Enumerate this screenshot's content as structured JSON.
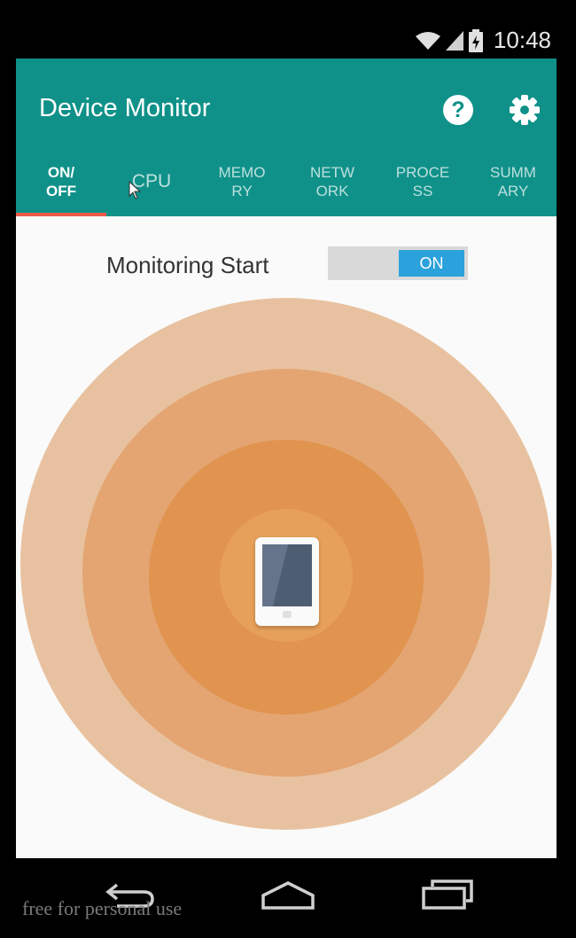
{
  "status_bar": {
    "time": "10:48",
    "icons": [
      "wifi-icon",
      "signal-icon",
      "battery-icon"
    ]
  },
  "toolbar": {
    "title": "Device Monitor",
    "help_icon": "?",
    "color": "#0f9189"
  },
  "tabs": [
    {
      "line1": "ON/",
      "line2": "OFF",
      "active": true
    },
    {
      "line1": "CPU",
      "line2": ""
    },
    {
      "line1": "MEMO",
      "line2": "RY"
    },
    {
      "line1": "NETW",
      "line2": "ORK"
    },
    {
      "line1": "PROCE",
      "line2": "SS"
    },
    {
      "line1": "SUMM",
      "line2": "ARY"
    }
  ],
  "monitor": {
    "label": "Monitoring Start",
    "toggle_label": "ON",
    "toggle_state": "on"
  },
  "radar": {
    "colors": [
      "#e8c2a0",
      "#e4a572",
      "#e0944f",
      "#e7a059"
    ],
    "center_icon": "tablet-icon"
  },
  "watermark": "free for personal use",
  "nav_icons": [
    "back-icon",
    "home-icon",
    "recent-apps-icon"
  ],
  "accent_colors": {
    "indicator": "#ee5a4a",
    "toggle": "#2ba2dc"
  }
}
